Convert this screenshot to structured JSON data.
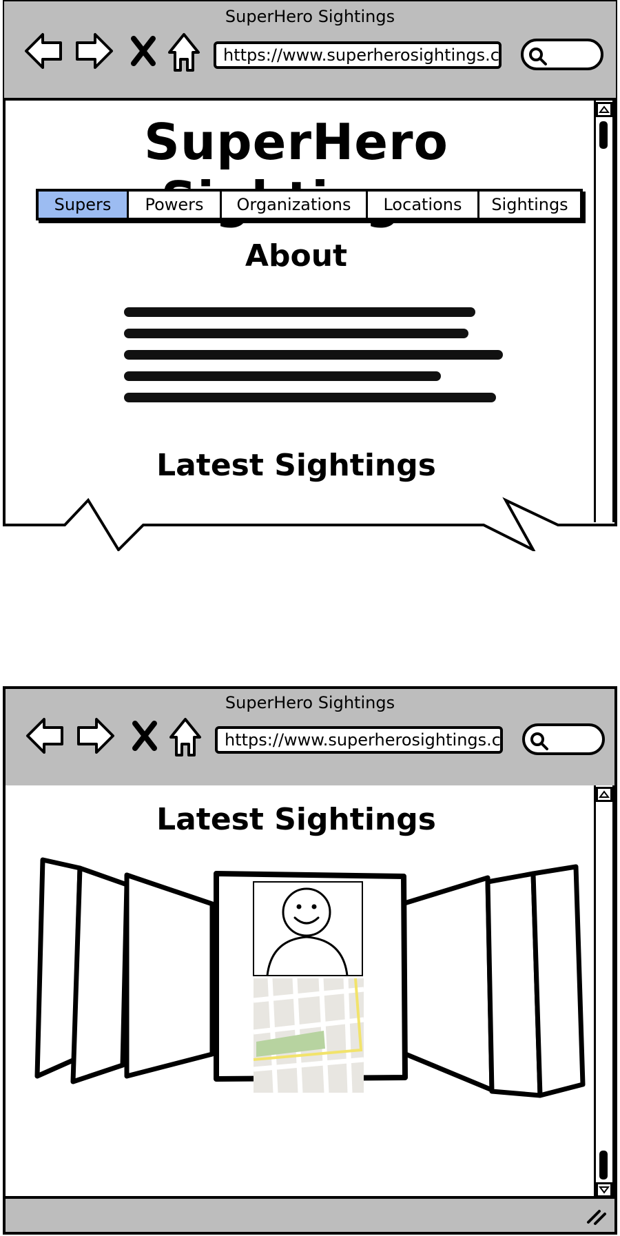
{
  "window": {
    "title": "SuperHero Sightings",
    "url": "https://www.superherosightings.c"
  },
  "nav_icons": [
    "back-arrow-icon",
    "forward-arrow-icon",
    "close-x-icon",
    "home-icon",
    "search-icon"
  ],
  "site": {
    "title": "SuperHero Sightings"
  },
  "tabs": [
    {
      "label": "Supers",
      "active": true
    },
    {
      "label": "Powers",
      "active": false
    },
    {
      "label": "Organizations",
      "active": false
    },
    {
      "label": "Locations",
      "active": false
    },
    {
      "label": "Sightings",
      "active": false
    }
  ],
  "about": {
    "heading": "About"
  },
  "latest": {
    "heading": "Latest Sightings"
  },
  "colors": {
    "active_tab": "#9cbcf2",
    "chrome": "#bdbdbd",
    "map_park": "#b7d3a0",
    "map_road": "#f2e36b"
  }
}
